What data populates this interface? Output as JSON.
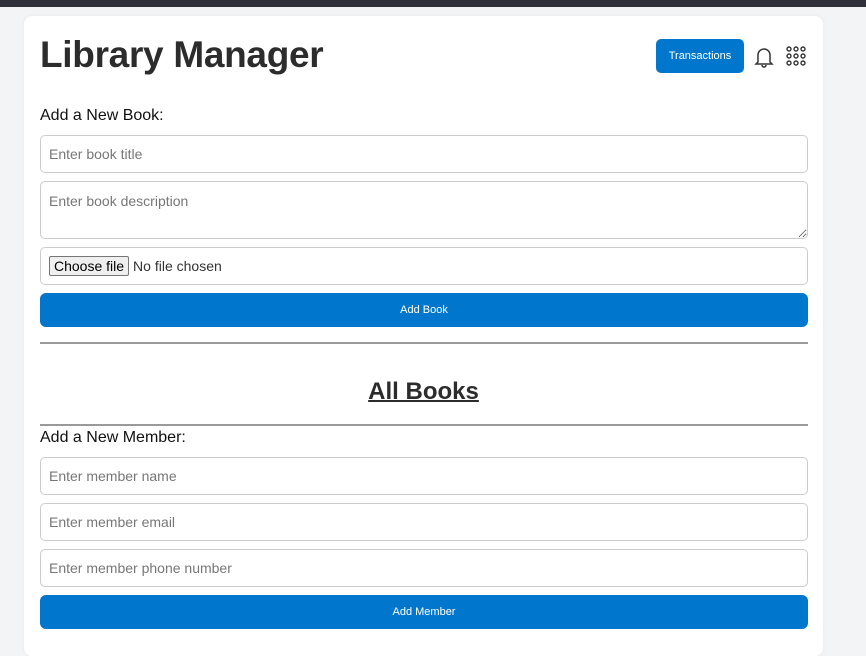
{
  "header": {
    "title": "Library Manager",
    "transactions_label": "Transactions"
  },
  "book_form": {
    "heading": "Add a New Book:",
    "title_placeholder": "Enter book title",
    "description_placeholder": "Enter book description",
    "file_button": "Choose file",
    "file_status": "No file chosen",
    "submit_label": "Add Book"
  },
  "books_section": {
    "heading": "All Books"
  },
  "member_form": {
    "heading": "Add a New Member:",
    "name_placeholder": "Enter member name",
    "email_placeholder": "Enter member email",
    "phone_placeholder": "Enter member phone number",
    "submit_label": "Add Member"
  },
  "colors": {
    "accent": "#0077cc"
  }
}
